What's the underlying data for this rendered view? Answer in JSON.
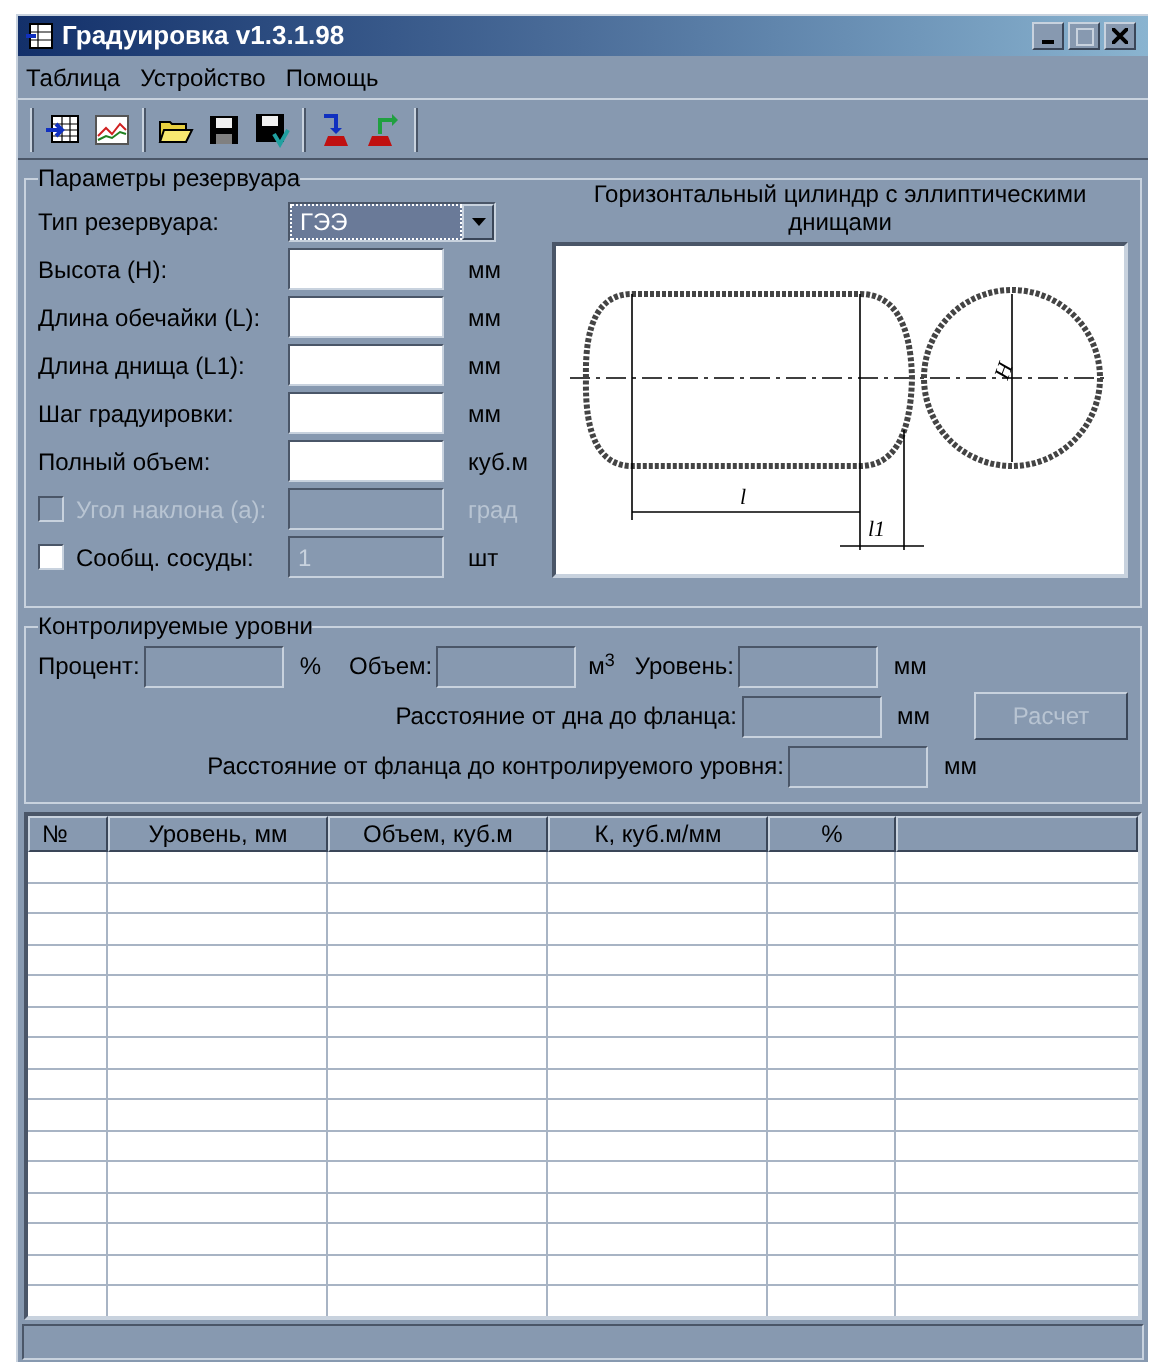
{
  "window": {
    "title": "Градуировка v1.3.1.98"
  },
  "menu": [
    "Таблица",
    "Устройство",
    "Помощь"
  ],
  "params": {
    "legend": "Параметры резервуара",
    "type": {
      "label": "Тип резервуара:",
      "value": "ГЭЭ"
    },
    "fields": [
      {
        "kind": "input",
        "label": "Высота (H):",
        "unit": "мм"
      },
      {
        "kind": "input",
        "label": "Длина обечайки (L):",
        "unit": "мм"
      },
      {
        "kind": "input",
        "label": "Длина днища (L1):",
        "unit": "мм"
      },
      {
        "kind": "input",
        "label": "Шаг градуировки:",
        "unit": "мм"
      },
      {
        "kind": "input",
        "label": "Полный объем:",
        "unit": "куб.м"
      },
      {
        "kind": "check",
        "label": "Угол наклона (a):",
        "unit": "град",
        "checked": false,
        "disabled": true
      },
      {
        "kind": "check",
        "label": "Сообщ. сосуды:",
        "unit": "шт",
        "checked": false,
        "disabled": false,
        "value": "1"
      }
    ],
    "diagram": {
      "caption": "Горизонтальный цилиндр с эллиптическими днищами",
      "length_label": "l",
      "bottom_label": "l1",
      "diameter_label": "H"
    }
  },
  "levels": {
    "legend": "Контролируемые уровни",
    "percent": {
      "label": "Процент:",
      "unit": "%"
    },
    "volume": {
      "label": "Объем:",
      "unit": "м$^{3}$"
    },
    "level": {
      "label": "Уровень:",
      "unit": "мм"
    },
    "rows": [
      {
        "label": "Расстояние от дна до фланца:",
        "unit": "мм"
      },
      {
        "label": "Расстояние от фланца до контролируемого уровня:",
        "unit": "мм"
      }
    ],
    "button": {
      "label": "Расчет",
      "disabled": true
    }
  },
  "table": {
    "columns": [
      "№",
      "Уровень, мм",
      "Объем, куб.м",
      "К, куб.м/мм",
      "%"
    ]
  }
}
